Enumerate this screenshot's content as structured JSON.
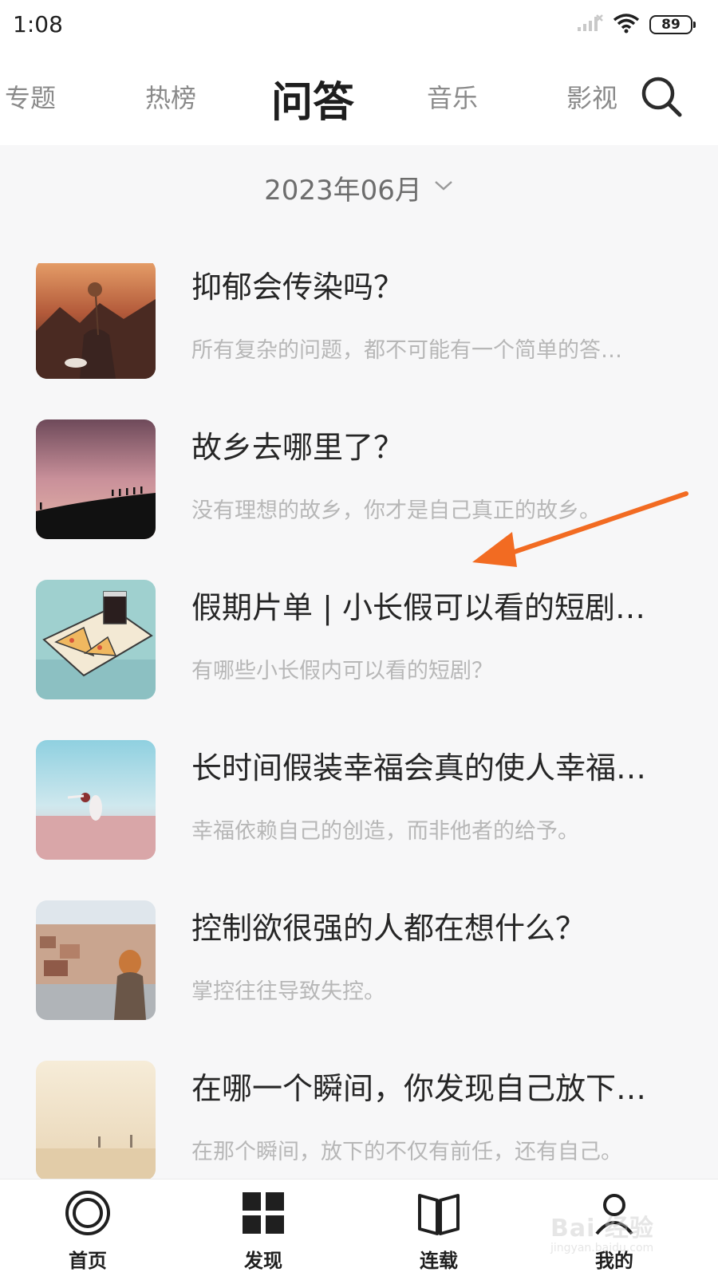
{
  "status_bar": {
    "time": "1:08",
    "battery": "89",
    "signal_icon": "signal-icon",
    "wifi_icon": "wifi-icon"
  },
  "top_tabs": [
    {
      "label": "专题",
      "active": false
    },
    {
      "label": "热榜",
      "active": false
    },
    {
      "label": "问答",
      "active": true
    },
    {
      "label": "音乐",
      "active": false
    },
    {
      "label": "影视",
      "active": false
    }
  ],
  "search_icon": "search-icon",
  "month_selector": {
    "label": "2023年06月",
    "icon": "chevron-down-icon"
  },
  "items": [
    {
      "title": "抑郁会传染吗？",
      "subtitle": "所有复杂的问题，都不可能有一个简单的答…",
      "thumb": "flower-sunset"
    },
    {
      "title": "故乡去哪里了？",
      "subtitle": "没有理想的故乡，你才是自己真正的故乡。",
      "thumb": "hill-silhouettes"
    },
    {
      "title": "假期片单 | 小长假可以看的短剧…",
      "subtitle": "有哪些小长假内可以看的短剧？",
      "thumb": "pizza-tray"
    },
    {
      "title": "长时间假装幸福会真的使人幸福…",
      "subtitle": "幸福依赖自己的创造，而非他者的给予。",
      "thumb": "field-dancer"
    },
    {
      "title": "控制欲很强的人都在想什么？",
      "subtitle": "掌控往往导致失控。",
      "thumb": "city-rooftop"
    },
    {
      "title": "在哪一个瞬间，你发现自己放下…",
      "subtitle": "在那个瞬间，放下的不仅有前任，还有自己。",
      "thumb": "misty-beach"
    }
  ],
  "annotation": {
    "color": "#f26b22"
  },
  "bottom_nav": [
    {
      "label": "首页",
      "icon": "home-circle-icon"
    },
    {
      "label": "发现",
      "icon": "discover-grid-icon"
    },
    {
      "label": "连载",
      "icon": "book-icon"
    },
    {
      "label": "我的",
      "icon": "profile-icon"
    }
  ],
  "watermark": {
    "text": "Bai 经验",
    "sub": "jingyan.baidu.com"
  },
  "colors": {
    "accent_text": "#1e1e1e",
    "muted_text": "#8a8a8a",
    "subtitle_text": "#b7b7b7",
    "background": "#f7f7f8"
  }
}
